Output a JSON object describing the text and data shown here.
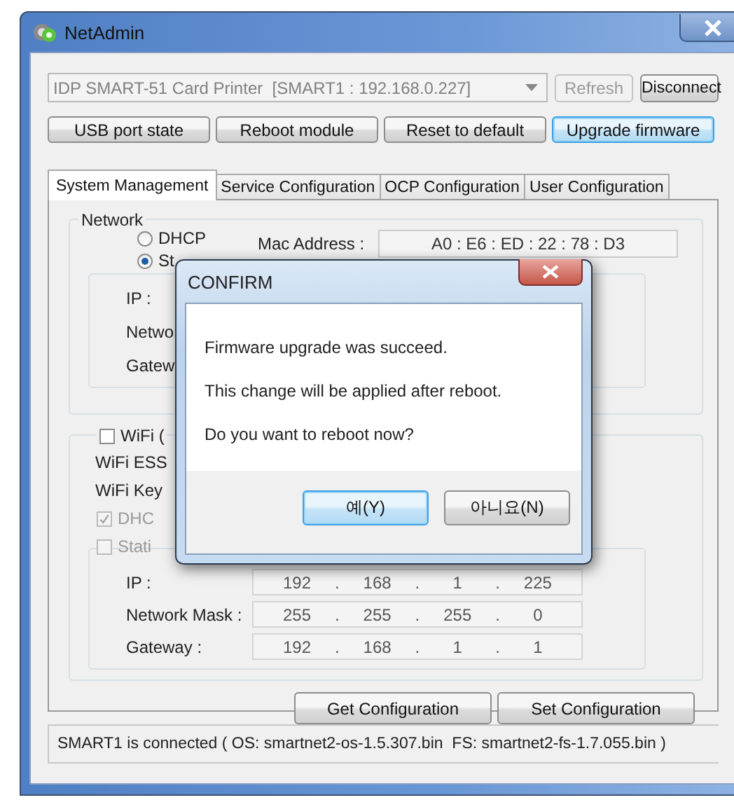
{
  "window": {
    "title": "NetAdmin"
  },
  "device_select": {
    "value": "IDP SMART-51 Card Printer  [SMART1 : 192.168.0.227]",
    "disabled": true
  },
  "top_buttons": [
    {
      "label": "Refresh",
      "disabled": true
    },
    {
      "label": "Disconnect",
      "disabled": false
    }
  ],
  "actions": [
    {
      "label": "USB port state",
      "focused": false
    },
    {
      "label": "Reboot module",
      "focused": false
    },
    {
      "label": "Reset to default",
      "focused": false
    },
    {
      "label": "Upgrade firmware",
      "focused": true
    }
  ],
  "tabs": [
    {
      "label": "System Management",
      "selected": true
    },
    {
      "label": "Service Configuration",
      "selected": false
    },
    {
      "label": "OCP Configuration",
      "selected": false
    },
    {
      "label": "User Configuration",
      "selected": false
    }
  ],
  "network": {
    "title": "Network",
    "modes": [
      {
        "label": "DHCP",
        "selected": false
      },
      {
        "label": "St",
        "selected": true
      }
    ],
    "mac_label": "Mac Address :",
    "mac_value": "A0 : E6 : ED : 22 : 78 : D3",
    "field_labels": [
      "IP :",
      "Netwo",
      "Gatew"
    ]
  },
  "wifi": {
    "enable": {
      "label": "WiFi (",
      "checked": false
    },
    "row_labels": [
      "WiFi ESS",
      "WiFi Key"
    ],
    "options": [
      {
        "label": "DHC",
        "checked": true,
        "disabled": true
      },
      {
        "label": "Stati",
        "checked": false,
        "disabled": true
      }
    ],
    "fields": [
      {
        "label": "IP :",
        "octets": [
          "192",
          "168",
          "1",
          "225"
        ]
      },
      {
        "label": "Network Mask :",
        "octets": [
          "255",
          "255",
          "255",
          "0"
        ]
      },
      {
        "label": "Gateway :",
        "octets": [
          "192",
          "168",
          "1",
          "1"
        ]
      }
    ],
    "separator": "."
  },
  "config_buttons": [
    "Get Configuration",
    "Set Configuration"
  ],
  "status": "SMART1 is connected ( OS: smartnet2-os-1.5.307.bin  FS: smartnet2-fs-1.7.055.bin )",
  "dialog": {
    "title": "CONFIRM",
    "lines": [
      "Firmware upgrade was succeed.",
      "This change will be applied after reboot.",
      "Do you want to reboot now?"
    ],
    "buttons": [
      {
        "label": "예(Y)",
        "default": true
      },
      {
        "label": "아니요(N)",
        "default": false
      }
    ]
  }
}
